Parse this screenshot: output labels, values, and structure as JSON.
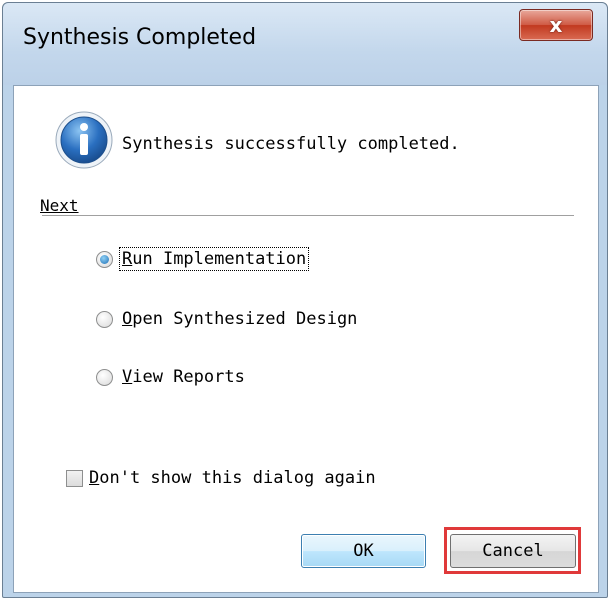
{
  "window": {
    "title": "Synthesis Completed",
    "close_symbol": "x"
  },
  "message": {
    "icon": "info-icon",
    "text": "Synthesis successfully completed."
  },
  "next_section": {
    "label": "Next",
    "options": [
      {
        "mnemonic": "R",
        "rest": "un Implementation",
        "selected": true
      },
      {
        "mnemonic": "O",
        "rest": "pen Synthesized Design",
        "selected": false
      },
      {
        "mnemonic": "V",
        "rest": "iew Reports",
        "selected": false
      }
    ]
  },
  "dont_show": {
    "mnemonic": "D",
    "rest": "on't show this dialog again",
    "checked": false
  },
  "buttons": {
    "ok_label": "OK",
    "cancel_label": "Cancel"
  },
  "colors": {
    "highlight_box": "#e0393a",
    "title_bar": "#c3d7ec",
    "close_button": "#c1391f"
  }
}
